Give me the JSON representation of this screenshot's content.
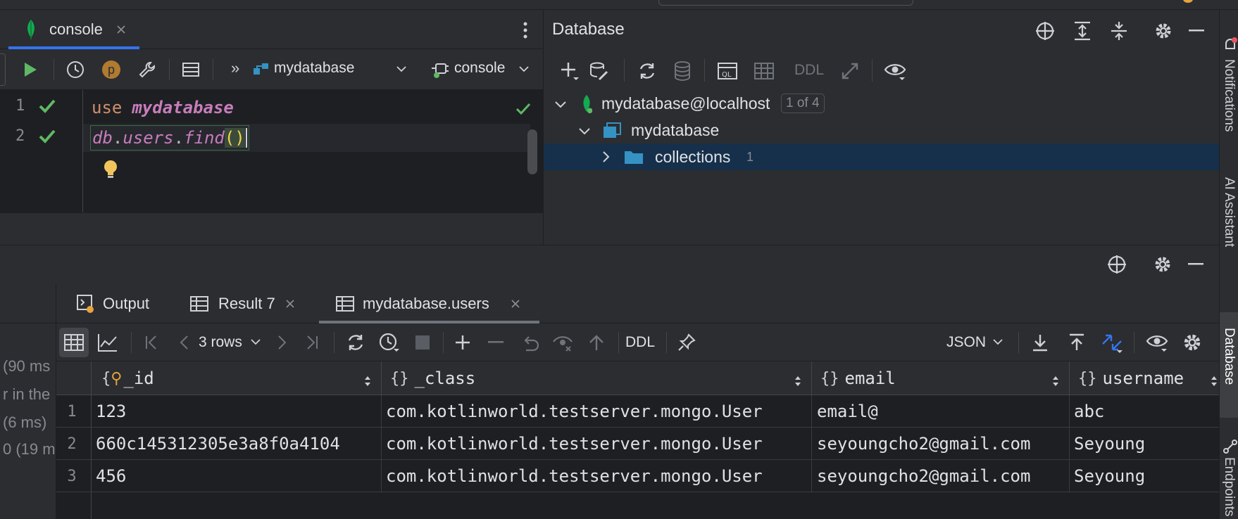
{
  "editor": {
    "tab_label": "console",
    "toolbar": {
      "database": "mydatabase",
      "console": "console",
      "more": "»",
      "profile_letter": "p"
    },
    "gutter": [
      "1",
      "2"
    ],
    "lines": [
      {
        "kw": "use",
        "rest": "mydatabase"
      },
      {
        "obj": "db",
        "dot1": ".",
        "coll": "users",
        "dot2": ".",
        "fn": "find",
        "paren": "()"
      }
    ]
  },
  "database_panel": {
    "title": "Database",
    "toolbar": {
      "ddl": "DDL"
    },
    "tree": [
      {
        "label": "mydatabase@localhost",
        "badge": "1 of 4"
      },
      {
        "label": "mydatabase"
      },
      {
        "label": "collections",
        "count": "1"
      }
    ]
  },
  "right_strip": {
    "notifications": "Notifications",
    "ai": "AI Assistant",
    "database": "Database",
    "endpoints": "Endpoints"
  },
  "left_log": [
    "(90 ms",
    "r in the",
    "(6 ms)",
    "0 (19 m"
  ],
  "results": {
    "tabs": [
      {
        "label": "Output"
      },
      {
        "label": "Result 7"
      },
      {
        "label": "mydatabase.users"
      }
    ],
    "toolbar": {
      "rows": "3 rows",
      "ddl": "DDL",
      "format": "JSON"
    },
    "columns": [
      "_id",
      "_class",
      "email",
      "username"
    ],
    "rows": [
      {
        "num": "1",
        "_id": "123",
        "_class": "com.kotlinworld.testserver.mongo.User",
        "email": "email@",
        "username": "abc"
      },
      {
        "num": "2",
        "_id": "660c145312305e3a8f0a4104",
        "_class": "com.kotlinworld.testserver.mongo.User",
        "email": "seyoungcho2@gmail.com",
        "username": "Seyoung"
      },
      {
        "num": "3",
        "_id": "456",
        "_class": "com.kotlinworld.testserver.mongo.User",
        "email": "seyoungcho2@gmail.com",
        "username": "Seyoung"
      }
    ]
  },
  "colors": {
    "background": "#2b2d30",
    "editor_bg": "#1e1f22",
    "accent_blue": "#3574f0",
    "selection": "#16304b",
    "keyword": "#cf8e6d",
    "identifier": "#c77dbb",
    "success_green": "#5fb865"
  }
}
